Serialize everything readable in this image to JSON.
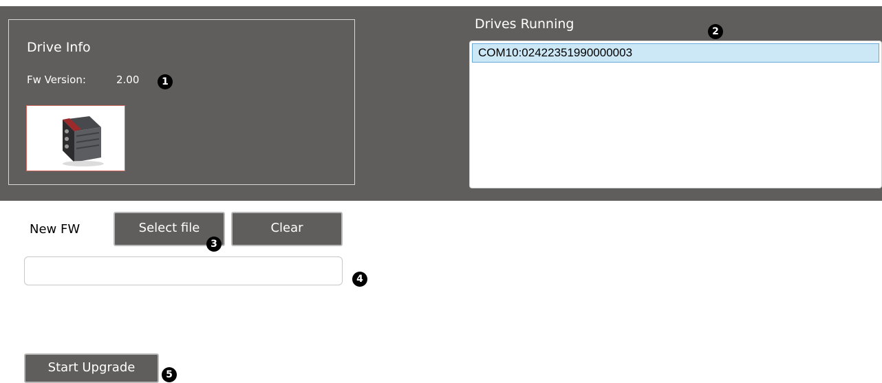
{
  "drive_info": {
    "title": "Drive Info",
    "fw_label": "Fw Version:",
    "fw_value": "2.00",
    "product_image_alt": "Drive"
  },
  "drives_running": {
    "title": "Drives Running",
    "items": [
      "COM10:02422351990000003"
    ]
  },
  "new_fw": {
    "label": "New FW",
    "select_button": "Select file",
    "clear_button": "Clear",
    "file_path_value": "",
    "file_path_placeholder": ""
  },
  "actions": {
    "start_button": "Start Upgrade"
  },
  "markers": [
    "1",
    "2",
    "3",
    "4",
    "5"
  ],
  "colors": {
    "panel_bg": "#5f5e5d",
    "button_bg": "#5f5e5d",
    "selection_bg": "#cce8f6",
    "selection_border": "#66aadc",
    "image_border": "#d46a5e"
  }
}
